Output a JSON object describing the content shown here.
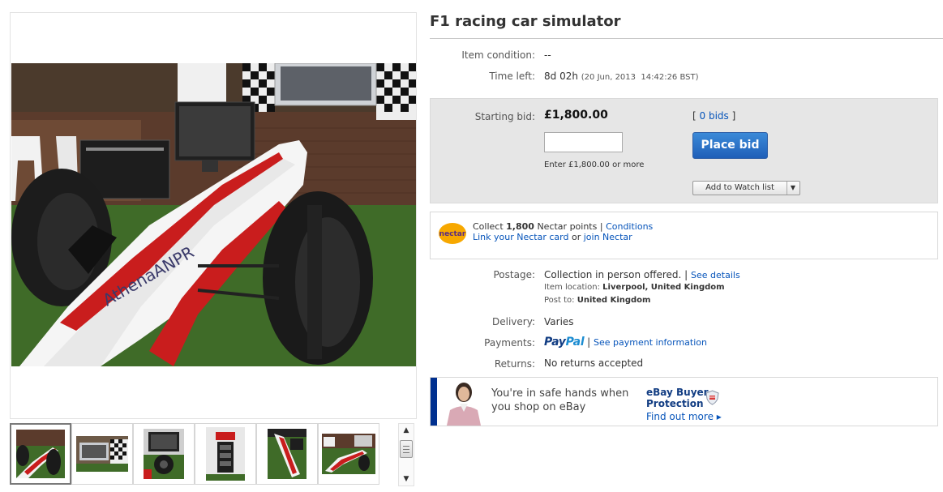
{
  "listing": {
    "title": "F1 racing car simulator"
  },
  "gallery": {
    "main_image_name": "f1-car-photo",
    "thumbnails": [
      {
        "name": "f1-car-front"
      },
      {
        "name": "screen-and-checkered-flag"
      },
      {
        "name": "cockpit-steering-wheel"
      },
      {
        "name": "lap-timer-sign"
      },
      {
        "name": "car-side-on-grass"
      },
      {
        "name": "car-in-garden"
      }
    ],
    "scroll_up": "▲",
    "scroll_down": "▼"
  },
  "details": {
    "condition_label": "Item condition:",
    "condition_value": "--",
    "time_left_label": "Time left:",
    "time_left_value": "8d 02h",
    "time_left_date": "(20 Jun, 2013  14:42:26 BST)"
  },
  "bidding": {
    "starting_bid_label": "Starting bid:",
    "starting_bid_value": "£1,800.00",
    "bids_open": "[ ",
    "bids_link": "0 bids",
    "bids_close": " ]",
    "input_value": "",
    "place_bid_label": "Place bid",
    "enter_hint": "Enter £1,800.00 or more",
    "watch_label": "Add to Watch list",
    "watch_arrow": "▼"
  },
  "nectar": {
    "logo_text": "nectar",
    "collect_prefix": "Collect ",
    "points": "1,800",
    "collect_suffix": " Nectar points | ",
    "conditions_link": "Conditions",
    "link_card": "Link your Nectar card",
    "or_text": " or ",
    "join_link": "join Nectar"
  },
  "shipping": {
    "postage_label": "Postage:",
    "postage_value": "Collection in person offered.",
    "postage_sep": " | ",
    "see_details": "See details",
    "item_location_label": "Item location: ",
    "item_location_value": "Liverpool, United Kingdom",
    "post_to_label": "Post to: ",
    "post_to_value": "United Kingdom",
    "delivery_label": "Delivery:",
    "delivery_value": "Varies",
    "payments_label": "Payments:",
    "paypal_part1": "Pay",
    "paypal_part2": "Pal",
    "payments_sep": " | ",
    "see_payment_info": "See payment information",
    "returns_label": "Returns:",
    "returns_value": "No returns accepted"
  },
  "protection": {
    "line1": "You're in safe hands when",
    "line2": "you shop on eBay",
    "ebay_line1": "eBay Buyer",
    "ebay_line2": "Protection",
    "find_out": "Find out more ▸"
  },
  "colors": {
    "link": "#0654ba",
    "button": "#1f5fb8",
    "bidbox": "#e6e6e6",
    "paypal_dark": "#123d83",
    "paypal_light": "#1b8cd1",
    "protection_bar": "#00308f"
  }
}
